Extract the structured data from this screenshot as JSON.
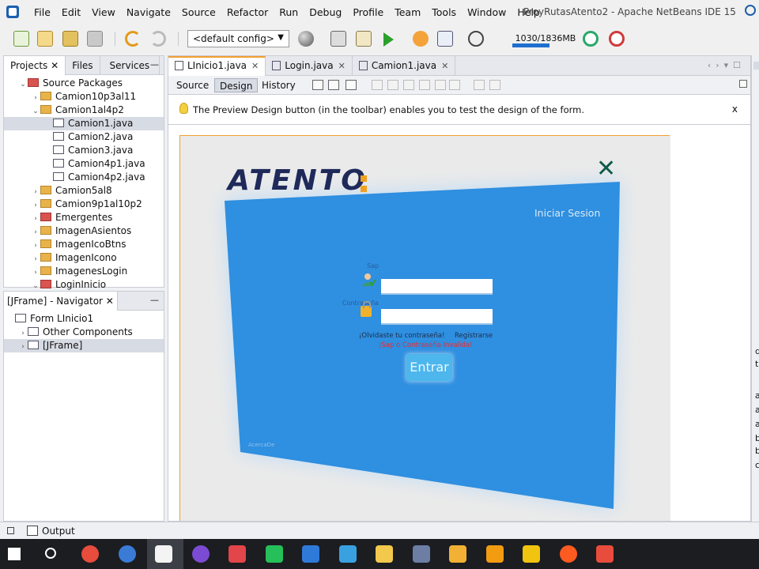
{
  "window": {
    "title": "ProyRutasAtento2 - Apache NetBeans IDE 15"
  },
  "menubar": {
    "items": [
      "File",
      "Edit",
      "View",
      "Navigate",
      "Source",
      "Refactor",
      "Run",
      "Debug",
      "Profile",
      "Team",
      "Tools",
      "Window",
      "Help"
    ]
  },
  "toolbar": {
    "config_value": "<default config>",
    "memory_label": "1030/1836MB",
    "memory_fraction": 0.56
  },
  "projects_pane": {
    "tabs": [
      "Projects",
      "Files",
      "Services"
    ],
    "tree": [
      {
        "label": "Source Packages",
        "indent": 1,
        "expanded": true,
        "kind": "pkg-red",
        "selected": false
      },
      {
        "label": "Camion10p3al11",
        "indent": 2,
        "expanded": false,
        "kind": "pkg",
        "selected": false
      },
      {
        "label": "Camion1al4p2",
        "indent": 2,
        "expanded": true,
        "kind": "pkg",
        "selected": false
      },
      {
        "label": "Camion1.java",
        "indent": 3,
        "expanded": null,
        "kind": "file",
        "selected": true
      },
      {
        "label": "Camion2.java",
        "indent": 3,
        "expanded": null,
        "kind": "file",
        "selected": false
      },
      {
        "label": "Camion3.java",
        "indent": 3,
        "expanded": null,
        "kind": "file",
        "selected": false
      },
      {
        "label": "Camion4p1.java",
        "indent": 3,
        "expanded": null,
        "kind": "file",
        "selected": false
      },
      {
        "label": "Camion4p2.java",
        "indent": 3,
        "expanded": null,
        "kind": "file",
        "selected": false
      },
      {
        "label": "Camion5al8",
        "indent": 2,
        "expanded": false,
        "kind": "pkg",
        "selected": false
      },
      {
        "label": "Camion9p1al10p2",
        "indent": 2,
        "expanded": false,
        "kind": "pkg",
        "selected": false
      },
      {
        "label": "Emergentes",
        "indent": 2,
        "expanded": false,
        "kind": "pkg-red",
        "selected": false
      },
      {
        "label": "ImagenAsientos",
        "indent": 2,
        "expanded": false,
        "kind": "pkg",
        "selected": false
      },
      {
        "label": "ImagenIcoBtns",
        "indent": 2,
        "expanded": false,
        "kind": "pkg",
        "selected": false
      },
      {
        "label": "ImagenIcono",
        "indent": 2,
        "expanded": false,
        "kind": "pkg",
        "selected": false
      },
      {
        "label": "ImagenesLogin",
        "indent": 2,
        "expanded": false,
        "kind": "pkg",
        "selected": false
      },
      {
        "label": "LoginInicio",
        "indent": 2,
        "expanded": true,
        "kind": "pkg-red",
        "selected": false
      }
    ]
  },
  "navigator_pane": {
    "title": "[JFrame] - Navigator",
    "tree": [
      {
        "label": "Form LInicio1",
        "indent": 0,
        "expanded": null,
        "kind": "form",
        "selected": false
      },
      {
        "label": "Other Components",
        "indent": 1,
        "expanded": false,
        "kind": "comp",
        "selected": false
      },
      {
        "label": "[JFrame]",
        "indent": 1,
        "expanded": false,
        "kind": "frame",
        "selected": true
      }
    ]
  },
  "editor": {
    "tabs": [
      {
        "label": "LInicio1.java",
        "active": true
      },
      {
        "label": "Login.java",
        "active": false
      },
      {
        "label": "Camion1.java",
        "active": false
      }
    ],
    "modes": [
      "Source",
      "Design",
      "History"
    ],
    "active_mode": "Design",
    "hint": "The Preview Design button (in the toolbar) enables you to test the design of the form.",
    "hint_close": "x"
  },
  "login_form": {
    "logo": "ATENTO",
    "close_glyph": "✕",
    "iniciar": "Iniciar Sesion",
    "sap_label": "Sap",
    "password_label": "Contraseña",
    "sap_value": "",
    "password_value": "",
    "forgot_link": "¡Olvidaste tu contraseña!",
    "register_link": "Registrarse",
    "error": "¡Sap o Contraseña Invalida!",
    "submit": "Entrar",
    "about": "AcercaDe",
    "colors": {
      "panel": "#2f8fe0",
      "panel_edge": "#bfdcf5",
      "logo": "#1f2a5a",
      "accent": "#f0a020"
    }
  },
  "right_strip": {
    "letters": [
      "d",
      "t",
      "a",
      "a",
      "a",
      "b",
      "b",
      "c"
    ]
  },
  "statusbar": {
    "output_label": "Output"
  },
  "taskbar": {
    "icons": [
      "windows-start-icon",
      "search-icon",
      "chrome-icon",
      "browser-icon",
      "netbeans-icon",
      "github-icon",
      "camera-icon",
      "whatsapp-icon",
      "appstore-icon",
      "photos-icon",
      "music-icon",
      "calculator-icon",
      "folder-icon",
      "sublime-icon",
      "video-icon",
      "brave-icon",
      "slides-icon"
    ]
  }
}
